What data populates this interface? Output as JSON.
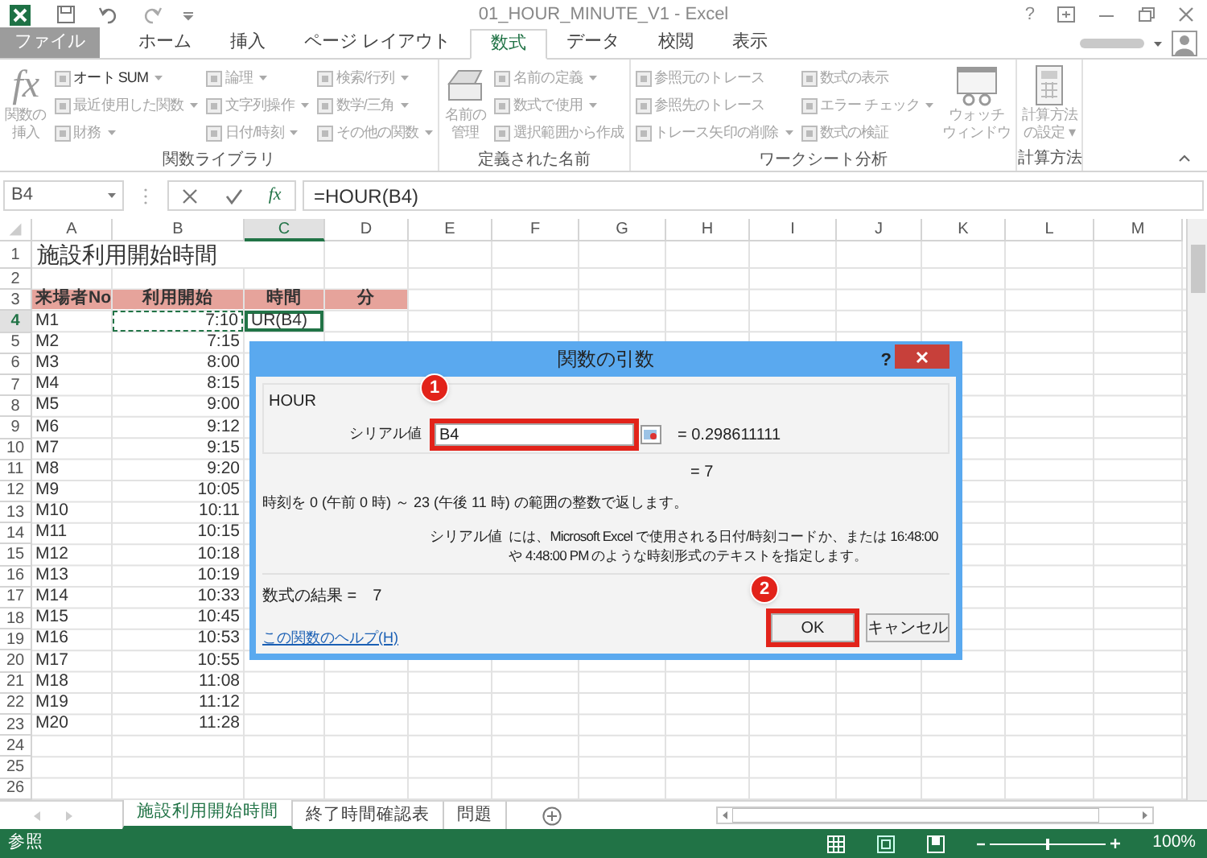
{
  "window": {
    "title": "01_HOUR_MINUTE_V1 - Excel",
    "help": "?"
  },
  "ribbon_tabs": [
    {
      "label": "ファイル",
      "selected": false,
      "kind": "file"
    },
    {
      "label": "ホーム",
      "selected": false,
      "kind": "tab"
    },
    {
      "label": "挿入",
      "selected": false,
      "kind": "tab"
    },
    {
      "label": "ページ レイアウト",
      "selected": false,
      "kind": "tab"
    },
    {
      "label": "数式",
      "selected": true,
      "kind": "tab"
    },
    {
      "label": "データ",
      "selected": false,
      "kind": "tab"
    },
    {
      "label": "校閲",
      "selected": false,
      "kind": "tab"
    },
    {
      "label": "表示",
      "selected": false,
      "kind": "tab"
    }
  ],
  "ribbon_groups": [
    {
      "label": "関数ライブラリ",
      "parts": [
        {
          "kind": "fx",
          "glyph": "fx",
          "lines": [
            "関数の",
            "挿入"
          ],
          "disabled": true
        },
        {
          "kind": "column",
          "items": [
            {
              "label": "オート SUM",
              "dropdown": true,
              "disabled": false
            },
            {
              "label": "最近使用した関数",
              "dropdown": true,
              "disabled": true
            },
            {
              "label": "財務",
              "dropdown": true,
              "disabled": true
            }
          ]
        },
        {
          "kind": "column",
          "items": [
            {
              "label": "論理",
              "dropdown": true,
              "disabled": true
            },
            {
              "label": "文字列操作",
              "dropdown": true,
              "disabled": true
            },
            {
              "label": "日付/時刻",
              "dropdown": true,
              "disabled": true
            }
          ]
        },
        {
          "kind": "column",
          "items": [
            {
              "label": "検索/行列",
              "dropdown": true,
              "disabled": true
            },
            {
              "label": "数学/三角",
              "dropdown": true,
              "disabled": true
            },
            {
              "label": "その他の関数",
              "dropdown": true,
              "disabled": true
            }
          ]
        }
      ]
    },
    {
      "label": "定義された名前",
      "parts": [
        {
          "kind": "tray",
          "lines": [
            "名前の",
            "管理"
          ],
          "disabled": true
        },
        {
          "kind": "column",
          "items": [
            {
              "label": "名前の定義",
              "dropdown": true,
              "disabled": true
            },
            {
              "label": "数式で使用",
              "dropdown": true,
              "disabled": true
            },
            {
              "label": "選択範囲から作成",
              "dropdown": false,
              "disabled": true
            }
          ]
        }
      ]
    },
    {
      "label": "ワークシート分析",
      "parts": [
        {
          "kind": "column",
          "items": [
            {
              "label": "参照元のトレース",
              "dropdown": false,
              "disabled": true
            },
            {
              "label": "参照先のトレース",
              "dropdown": false,
              "disabled": true
            },
            {
              "label": "トレース矢印の削除",
              "dropdown": true,
              "disabled": true
            }
          ]
        },
        {
          "kind": "column",
          "items": [
            {
              "label": "数式の表示",
              "dropdown": false,
              "disabled": true
            },
            {
              "label": "エラー チェック",
              "dropdown": true,
              "disabled": true
            },
            {
              "label": "数式の検証",
              "dropdown": false,
              "disabled": true
            }
          ]
        },
        {
          "kind": "watch",
          "lines": [
            "ウォッチ",
            "ウィンドウ"
          ],
          "disabled": true
        }
      ]
    },
    {
      "label": "計算方法",
      "parts": [
        {
          "kind": "calc",
          "lines": [
            "計算方法",
            "の設定 ▾"
          ],
          "disabled": true
        }
      ]
    }
  ],
  "formula_bar": {
    "name_box": "B4",
    "insert_function": "fx",
    "formula": "=HOUR(B4)"
  },
  "columns": [
    {
      "label": "A",
      "selected": false
    },
    {
      "label": "B",
      "selected": false
    },
    {
      "label": "C",
      "selected": true
    },
    {
      "label": "D",
      "selected": false
    },
    {
      "label": "E",
      "selected": false
    },
    {
      "label": "F",
      "selected": false
    },
    {
      "label": "G",
      "selected": false
    },
    {
      "label": "H",
      "selected": false
    },
    {
      "label": "I",
      "selected": false
    },
    {
      "label": "J",
      "selected": false
    },
    {
      "label": "K",
      "selected": false
    },
    {
      "label": "L",
      "selected": false
    },
    {
      "label": "M",
      "selected": false
    }
  ],
  "rows": [
    {
      "number": "1",
      "kind": "title",
      "selected": false,
      "cells": [
        "施設利用開始時間"
      ]
    },
    {
      "number": "2",
      "kind": "blank",
      "selected": false,
      "cells": []
    },
    {
      "number": "3",
      "kind": "header",
      "selected": false,
      "cells": [
        "来場者No",
        "利用開始",
        "時間",
        "分"
      ]
    },
    {
      "number": "4",
      "kind": "data",
      "selected": true,
      "cells": [
        "M1",
        {
          "text": "7:10",
          "marquee": true
        },
        "UR(B4)"
      ]
    },
    {
      "number": "5",
      "kind": "data",
      "selected": false,
      "cells": [
        "M2",
        "7:15"
      ]
    },
    {
      "number": "6",
      "kind": "data",
      "selected": false,
      "cells": [
        "M3",
        "8:00"
      ]
    },
    {
      "number": "7",
      "kind": "data",
      "selected": false,
      "cells": [
        "M4",
        "8:15"
      ]
    },
    {
      "number": "8",
      "kind": "data",
      "selected": false,
      "cells": [
        "M5",
        "9:00"
      ]
    },
    {
      "number": "9",
      "kind": "data",
      "selected": false,
      "cells": [
        "M6",
        "9:12"
      ]
    },
    {
      "number": "10",
      "kind": "data",
      "selected": false,
      "cells": [
        "M7",
        "9:15"
      ]
    },
    {
      "number": "11",
      "kind": "data",
      "selected": false,
      "cells": [
        "M8",
        "9:20"
      ]
    },
    {
      "number": "12",
      "kind": "data",
      "selected": false,
      "cells": [
        "M9",
        "10:05"
      ]
    },
    {
      "number": "13",
      "kind": "data",
      "selected": false,
      "cells": [
        "M10",
        "10:11"
      ]
    },
    {
      "number": "14",
      "kind": "data",
      "selected": false,
      "cells": [
        "M11",
        "10:15"
      ]
    },
    {
      "number": "15",
      "kind": "data",
      "selected": false,
      "cells": [
        "M12",
        "10:18"
      ]
    },
    {
      "number": "16",
      "kind": "data",
      "selected": false,
      "cells": [
        "M13",
        "10:19"
      ]
    },
    {
      "number": "17",
      "kind": "data",
      "selected": false,
      "cells": [
        "M14",
        "10:33"
      ]
    },
    {
      "number": "18",
      "kind": "data",
      "selected": false,
      "cells": [
        "M15",
        "10:45"
      ]
    },
    {
      "number": "19",
      "kind": "data",
      "selected": false,
      "cells": [
        "M16",
        "10:53"
      ]
    },
    {
      "number": "20",
      "kind": "data",
      "selected": false,
      "cells": [
        "M17",
        "10:55"
      ]
    },
    {
      "number": "21",
      "kind": "data",
      "selected": false,
      "cells": [
        "M18",
        "11:08"
      ]
    },
    {
      "number": "22",
      "kind": "data",
      "selected": false,
      "cells": [
        "M19",
        "11:12"
      ]
    },
    {
      "number": "23",
      "kind": "data",
      "selected": false,
      "cells": [
        "M20",
        "11:28"
      ]
    },
    {
      "number": "24",
      "kind": "blank",
      "selected": false,
      "cells": []
    },
    {
      "number": "25",
      "kind": "blank",
      "selected": false,
      "cells": []
    },
    {
      "number": "26",
      "kind": "blank",
      "selected": false,
      "cells": []
    }
  ],
  "dialog": {
    "title": "関数の引数",
    "help": "?",
    "function_name": "HOUR",
    "argument": {
      "label": "シリアル値",
      "value": "B4",
      "result": "= 0.298611111",
      "callout": "1"
    },
    "overall_result": "= 7",
    "description": "時刻を 0 (午前 0 時) ～ 23 (午後 11 時) の範囲の整数で返します。",
    "argument_help": {
      "label": "シリアル値",
      "text": "には、Microsoft Excel で使用される日付/時刻コードか、または 16:48:00 や 4:48:00 PM のような時刻形式のテキストを指定します。"
    },
    "formula_result": "数式の結果 =　7",
    "help_link": "この関数のヘルプ(H)",
    "buttons": [
      {
        "label": "OK",
        "callout": "2"
      },
      {
        "label": "キャンセル"
      }
    ]
  },
  "sheet_tabs": [
    {
      "label": "施設利用開始時間",
      "selected": true
    },
    {
      "label": "終了時間確認表",
      "selected": false
    },
    {
      "label": "問題",
      "selected": false
    }
  ],
  "status_bar": {
    "mode": "参照",
    "zoom": {
      "level": 0.5,
      "reading": "100%"
    }
  }
}
